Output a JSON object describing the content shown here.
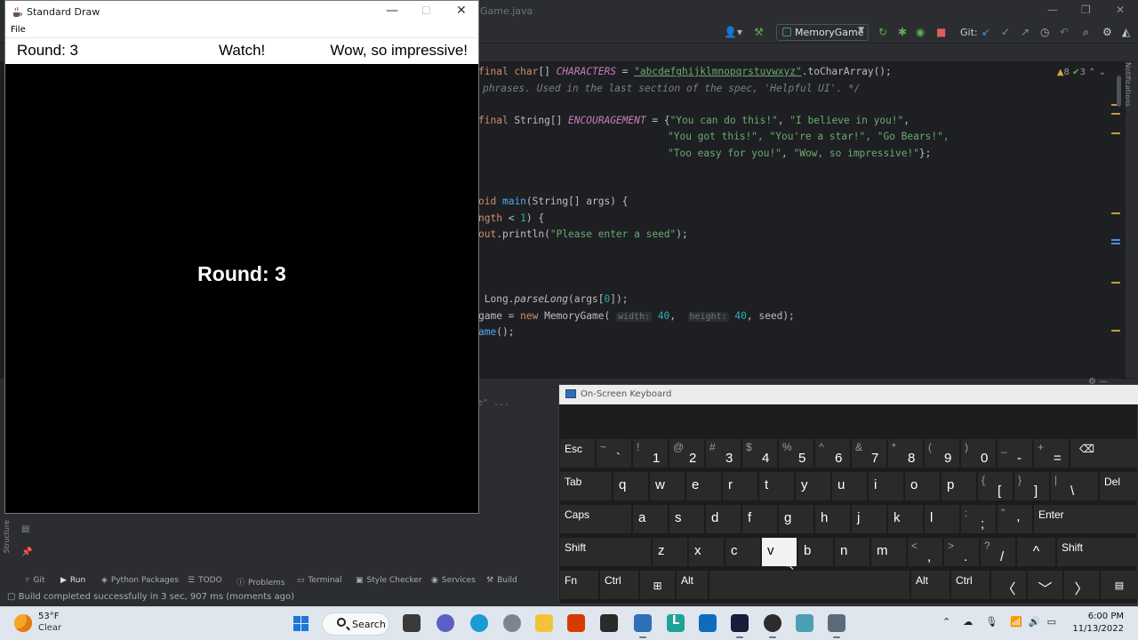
{
  "ide": {
    "open_file_fragment": "Game.java",
    "run_config": "MemoryGame",
    "git_label": "Git:",
    "inspections": {
      "warnings": "8",
      "checks": "3"
    },
    "code": [
      {
        "line": "final char[] CHARACTERS = \"abcdefghijklmnopqrstuvwxyz\".toCharArray();"
      },
      {
        "line": "phrases. Used in the last section of the spec, 'Helpful UI'. */"
      },
      {
        "line": "final String[] ENCOURAGEMENT = {\"You can do this!\", \"I believe in you!\","
      },
      {
        "line": "\"You got this!\", \"You're a star!\", \"Go Bears!\","
      },
      {
        "line": "\"Too easy for you!\", \"Wow, so impressive!\"};"
      },
      {
        "line": "oid main(String[] args) {"
      },
      {
        "line": "ngth < 1) {"
      },
      {
        "line": "out.println(\"Please enter a seed\");"
      },
      {
        "line": " Long.parseLong(args[0]);"
      },
      {
        "line": "game = new MemoryGame( width: 40,  height: 40, seed);"
      },
      {
        "line": "ame();"
      }
    ],
    "run_output_fragment": "e\" ...",
    "notifications_label": "Notifications",
    "structure_label": "Structure",
    "tool_tabs": [
      "Git",
      "Run",
      "Python Packages",
      "TODO",
      "Problems",
      "Terminal",
      "Style Checker",
      "Services",
      "Build"
    ],
    "status_text": "Build completed successfully in 3 sec, 907 ms (moments ago)"
  },
  "stddraw": {
    "title": "Standard Draw",
    "menu_file": "File",
    "hud": {
      "round": "Round: 3",
      "action": "Watch!",
      "encouragement": "Wow, so impressive!"
    },
    "center_text": "Round: 3"
  },
  "osk": {
    "title": "On-Screen Keyboard",
    "pressed_key": "v",
    "keys": {
      "esc": "Esc",
      "tab": "Tab",
      "caps": "Caps",
      "shift": "Shift",
      "enter": "Enter",
      "del": "Del",
      "fn": "Fn",
      "ctrl": "Ctrl",
      "alt": "Alt"
    }
  },
  "taskbar": {
    "weather_temp": "53°F",
    "weather_condition": "Clear",
    "search_label": "Search",
    "clock_time": "6:00 PM",
    "clock_date": "11/13/2022"
  },
  "colors": {
    "stddraw_canvas": "#000000",
    "hud_bar": "#ffffff",
    "ide_background": "#2b2d30",
    "editor_background": "#1e1f22",
    "key_background": "#2a2a2a",
    "key_pressed": "#f2f2f2",
    "taskbar": "#dfe6ee"
  }
}
